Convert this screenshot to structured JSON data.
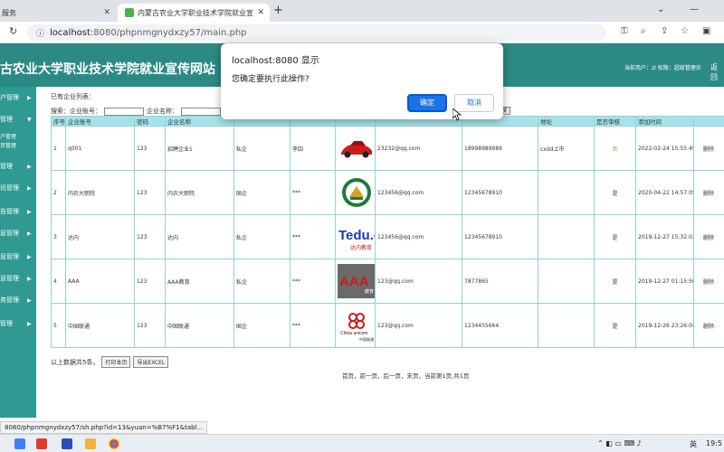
{
  "browser": {
    "tabs": [
      {
        "title": "服务"
      },
      {
        "title": "内蒙古农业大学职业技术学院就业宣传网站"
      }
    ],
    "url_host": "localhost",
    "url_rest": ":8080/phpnmgnydxzy57/main.php",
    "status_url": "8080/phpnmgnydxzy57/sh.php?id=13&yuan=%B7%F1&tabl..."
  },
  "site": {
    "title": "古农业大学职业技术学院就业宣传网站",
    "user_info": "当前用户：zl 权限：超级管理员",
    "logout": "返回"
  },
  "sidebar": {
    "items": [
      {
        "label": "户管理"
      },
      {
        "label": "管理"
      },
      {
        "label": "管理"
      },
      {
        "label": "讯管理"
      },
      {
        "label": "告管理"
      },
      {
        "label": "息管理"
      },
      {
        "label": "息管理"
      },
      {
        "label": "息管理"
      },
      {
        "label": "务管理"
      },
      {
        "label": "管理"
      }
    ],
    "submenu": [
      "户管理",
      "页管理"
    ]
  },
  "list": {
    "title": "已有企业列表：",
    "search_label1": "搜索：企业账号：",
    "search_label2": "企业名称：",
    "search_label3": "企",
    "search_button": "搜"
  },
  "table": {
    "headers": [
      "序号",
      "企业账号",
      "密码",
      "企业名称",
      "",
      "",
      "",
      "",
      "",
      "地址",
      "是否审核",
      "添加时间",
      ""
    ],
    "rows": [
      {
        "no": "1",
        "account": "q001",
        "password": "123",
        "name": "招聘企业1",
        "type": "私企",
        "contact": "李四",
        "email": "23232@qq.com",
        "phone": "18998989989",
        "address": "cxdd上市",
        "approved": "否",
        "time": "2022-02-24 15:55:49",
        "action": "删除",
        "logo": "car"
      },
      {
        "no": "2",
        "account": "内农大职院",
        "password": "123",
        "name": "内农大职院",
        "type": "国企",
        "contact": "***",
        "email": "123456@qq.com",
        "phone": "12345678910",
        "address": "",
        "approved": "是",
        "time": "2020-04-22 14:57:05",
        "action": "删除",
        "logo": "emblem"
      },
      {
        "no": "3",
        "account": "达内",
        "password": "123",
        "name": "达内",
        "type": "私企",
        "contact": "***",
        "email": "123456@qq.com",
        "phone": "12345678910",
        "address": "",
        "approved": "是",
        "time": "2019-12-27 15:32:02",
        "action": "删除",
        "logo": "tedu"
      },
      {
        "no": "4",
        "account": "AAA",
        "password": "123",
        "name": "AAA教育",
        "type": "私企",
        "contact": "***",
        "email": "123@qq.com",
        "phone": "7877865",
        "address": "",
        "approved": "是",
        "time": "2019-12-27 01:15:50",
        "action": "删除",
        "logo": "aaa"
      },
      {
        "no": "5",
        "account": "中国联通",
        "password": "123",
        "name": "中国联通",
        "type": "国企",
        "contact": "***",
        "email": "123@qq.com",
        "phone": "1234455664",
        "address": "",
        "approved": "是",
        "time": "2019-12-26 23:26:04",
        "action": "删除",
        "logo": "unicom"
      }
    ]
  },
  "logos": {
    "tedu_text": "Tedu.cn",
    "tedu_sub": "达内教育",
    "aaa_text": "AAA",
    "aaa_sub": "教育",
    "unicom_en": "China unicom",
    "unicom_cn": "中国联通"
  },
  "summary": {
    "text": "以上数据共5条。",
    "print_button": "打印本页",
    "export_button": "导出EXCEL"
  },
  "pager": {
    "text": "首页，前一页，后一页，末页，当前第1页,共1页"
  },
  "dialog": {
    "title": "localhost:8080 显示",
    "message": "您确定要执行此操作?",
    "ok": "确定",
    "cancel": "取消"
  },
  "taskbar": {
    "ime_lang": "英",
    "time": "19:5"
  },
  "colors": {
    "header_bg": "#2c8a84",
    "sidebar_bg": "#2e9a91",
    "table_header_bg": "#a6e3e9",
    "dialog_ok": "#1a73e8"
  }
}
